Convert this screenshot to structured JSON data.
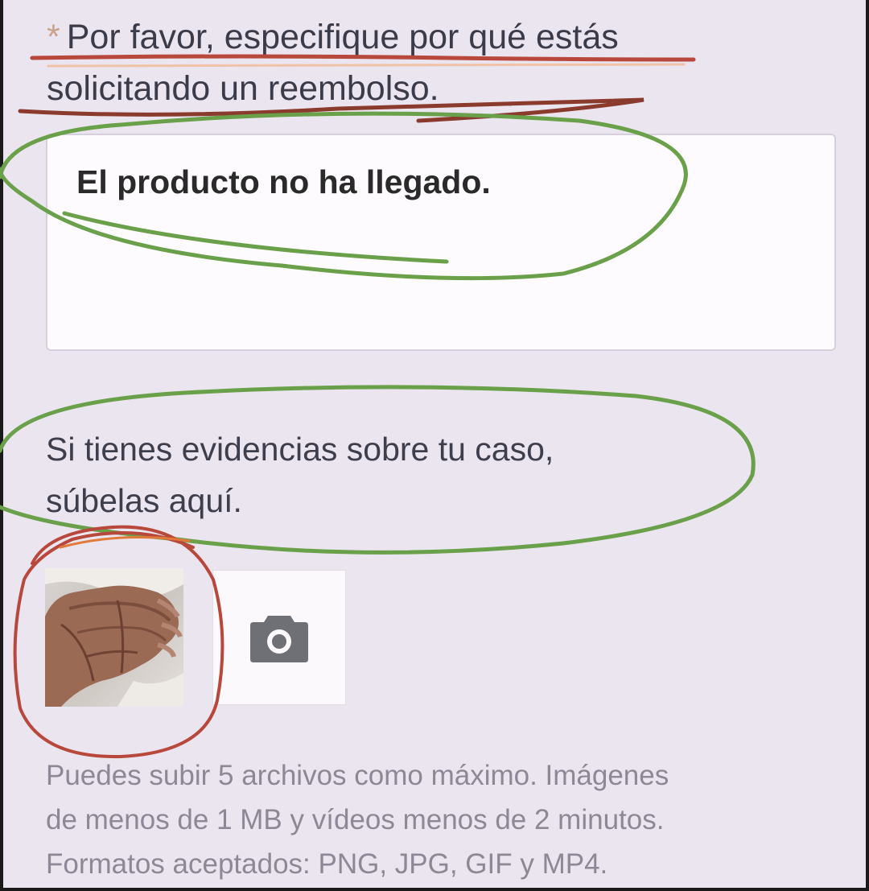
{
  "form": {
    "question_asterisk": "*",
    "question": "Por favor, especifique por qué estás solicitando un reembolso.",
    "answer": "El producto no ha llegado.",
    "evidence_label_line1": "Si tienes evidencias sobre tu caso,",
    "evidence_label_line2": "súbelas aquí.",
    "help_line1": "Puedes subir 5 archivos como máximo. Imágenes",
    "help_line2": "de menos de 1 MB y vídeos menos de 2 minutos.",
    "help_line3": "Formatos aceptados: PNG, JPG, GIF y MP4."
  },
  "upload": {
    "thumbnail": "hand-photo",
    "add_icon": "camera-icon"
  },
  "colors": {
    "background": "#ebe5ef",
    "green_marker": "#6aa04a",
    "red_marker": "#b8473c",
    "orange_marker": "#e07a3a"
  }
}
